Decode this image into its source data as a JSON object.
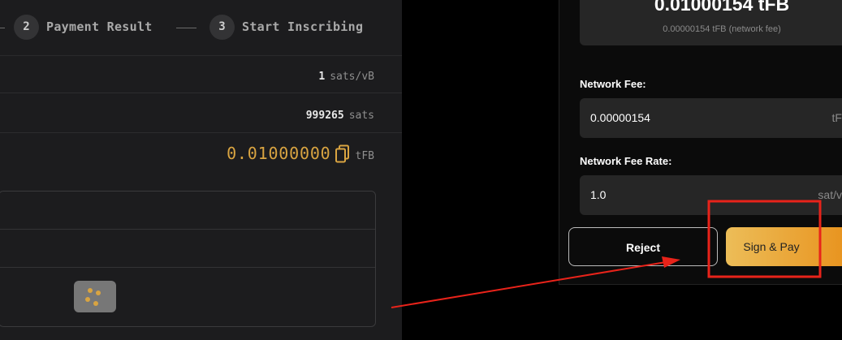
{
  "steps": [
    {
      "number": "2",
      "label": "Payment Result"
    },
    {
      "number": "3",
      "label": "Start Inscribing"
    }
  ],
  "summary_rows": {
    "fee_rate": {
      "value": "1",
      "unit": "sats/vB"
    },
    "amount_sats": {
      "value": "999265",
      "unit": "sats"
    },
    "pay_amount": {
      "value": "0.01000000",
      "unit": "tFB"
    }
  },
  "wallet": {
    "total": "0.01000154 tFB",
    "network_fee_note": "0.00000154 tFB (network fee)",
    "network_fee": {
      "label": "Network Fee:",
      "value": "0.00000154",
      "unit": "tF"
    },
    "network_fee_rate": {
      "label": "Network Fee Rate:",
      "value": "1.0",
      "unit": "sat/v"
    },
    "reject_label": "Reject",
    "sign_label": "Sign & Pay"
  },
  "colors": {
    "accent": "#d9a441",
    "annotation": "#e8231a"
  }
}
